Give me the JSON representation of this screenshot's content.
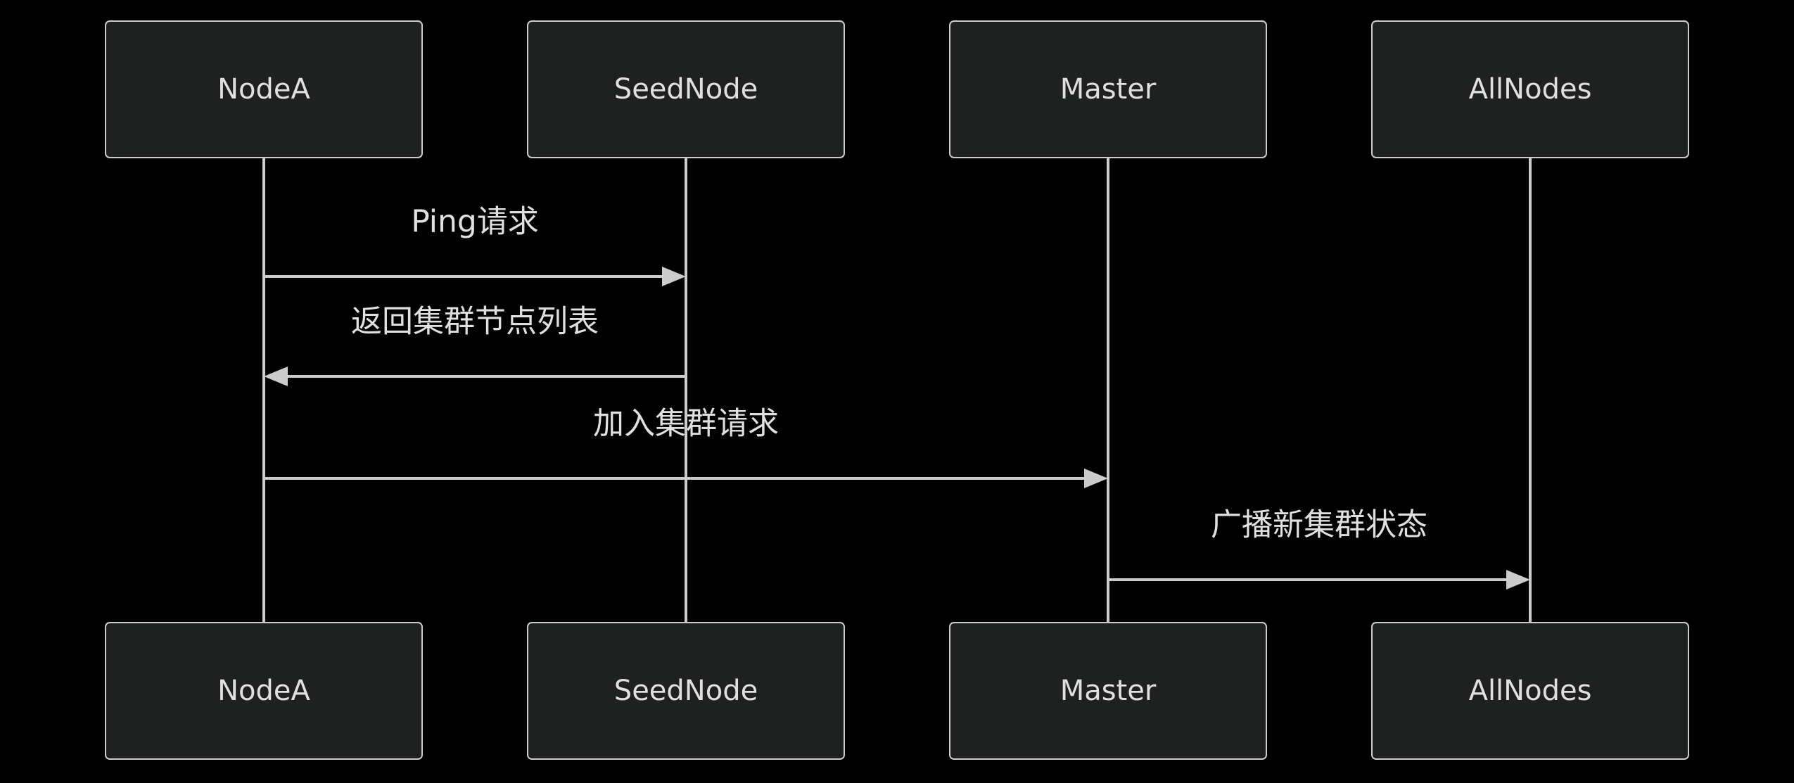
{
  "diagram": {
    "type": "sequence",
    "colors": {
      "background": "#000000",
      "box_fill": "#1f2020",
      "stroke": "#cccccc",
      "text": "#e0e0e0"
    },
    "participants": [
      {
        "id": "NodeA",
        "label": "NodeA"
      },
      {
        "id": "SeedNode",
        "label": "SeedNode"
      },
      {
        "id": "Master",
        "label": "Master"
      },
      {
        "id": "AllNodes",
        "label": "AllNodes"
      }
    ],
    "messages": [
      {
        "from": "NodeA",
        "to": "SeedNode",
        "label": "Ping请求"
      },
      {
        "from": "SeedNode",
        "to": "NodeA",
        "label": "返回集群节点列表"
      },
      {
        "from": "NodeA",
        "to": "Master",
        "label": "加入集群请求"
      },
      {
        "from": "Master",
        "to": "AllNodes",
        "label": "广播新集群状态"
      }
    ]
  }
}
